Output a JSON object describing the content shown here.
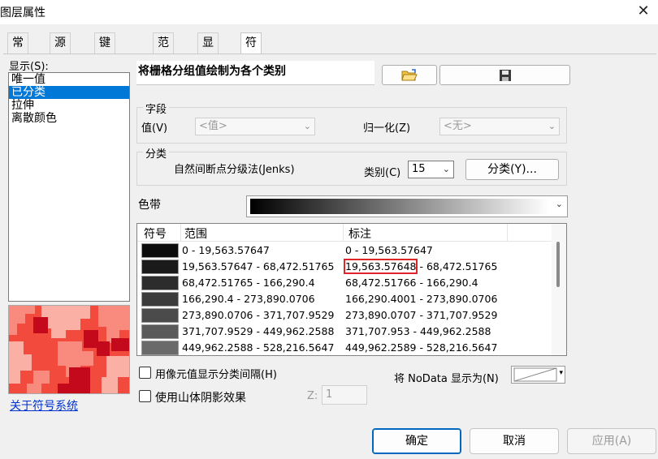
{
  "window": {
    "title": "图层属性",
    "close": "✕"
  },
  "tabs": [
    "常规",
    "源",
    "键元数据",
    "范围",
    "显示",
    "符号系统"
  ],
  "left": {
    "show_label": "显示(S):",
    "items": [
      "唯一值",
      "已分类",
      "拉伸",
      "离散颜色"
    ],
    "selected_index": 1,
    "about_link": "关于符号系统"
  },
  "description": "将栅格分组值绘制为各个类别",
  "buttons": {
    "open_icon": "folder-open-icon",
    "save_icon": "save-disk-icon"
  },
  "field": {
    "group_label": "字段",
    "value_label": "值(V)",
    "value_combo": "<值>",
    "normalize_label": "归一化(Z)",
    "normalize_combo": "<无>"
  },
  "classify": {
    "group_label": "分类",
    "method": "自然间断点分级法(Jenks)",
    "classes_label": "类别(C)",
    "classes_value": "15",
    "classify_button": "分类(Y)..."
  },
  "ramp": {
    "label": "色带",
    "colors": [
      "#000000",
      "#ffffff"
    ]
  },
  "table": {
    "headers": [
      "符号",
      "范围",
      "标注"
    ],
    "rows": [
      {
        "color": "#0c0c0c",
        "range": "0 - 19,563.57647",
        "label": "0 - 19,563.57647",
        "label_a": "",
        "label_b": ""
      },
      {
        "color": "#1a1a1a",
        "range": "19,563.57647 - 68,472.51765",
        "label": "",
        "label_a": "19,563.57648",
        "label_b": " - 68,472.51765"
      },
      {
        "color": "#2c2c2c",
        "range": "68,472.51765 - 166,290.4",
        "label": "68,472.51766 - 166,290.4",
        "label_a": "",
        "label_b": ""
      },
      {
        "color": "#3b3b3b",
        "range": "166,290.4 - 273,890.0706",
        "label": "166,290.4001 - 273,890.0706",
        "label_a": "",
        "label_b": ""
      },
      {
        "color": "#4b4b4b",
        "range": "273,890.0706 - 371,707.9529",
        "label": "273,890.0707 - 371,707.9529",
        "label_a": "",
        "label_b": ""
      },
      {
        "color": "#5a5a5a",
        "range": "371,707.9529 - 449,962.2588",
        "label": "371,707.953 - 449,962.2588",
        "label_a": "",
        "label_b": ""
      },
      {
        "color": "#6a6a6a",
        "range": "449,962.2588 - 528,216.5647",
        "label": "449,962.2589 - 528,216.5647",
        "label_a": "",
        "label_b": ""
      }
    ]
  },
  "options": {
    "show_class_breaks": "用像元值显示分类间隔(H)",
    "use_hillshade": "使用山体阴影效果",
    "z_label": "Z:",
    "z_value": "1",
    "nodata_label": "将 NoData 显示为(N)"
  },
  "footer": {
    "ok": "确定",
    "cancel": "取消",
    "apply": "应用(A)"
  }
}
